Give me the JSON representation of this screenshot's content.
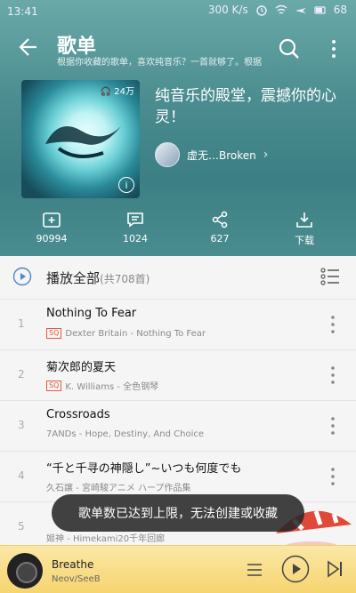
{
  "status": {
    "time": "13:41",
    "net_speed": "300 K/s",
    "battery": "68"
  },
  "header": {
    "title": "歌单",
    "subtitle": "根据你收藏的歌单，喜欢纯音乐？一首就够了。根据"
  },
  "playlist": {
    "play_count": "24万",
    "title": "纯音乐的殿堂，震撼你的心灵！",
    "creator": "虚无…Broken",
    "info_label": "i"
  },
  "actions": [
    {
      "label": "90994",
      "icon": "add-folder-icon"
    },
    {
      "label": "1024",
      "icon": "comment-icon"
    },
    {
      "label": "627",
      "icon": "share-icon"
    },
    {
      "label": "下载",
      "icon": "download-icon"
    }
  ],
  "playall": {
    "label": "播放全部",
    "count": "(共708首)"
  },
  "songs": [
    {
      "num": "1",
      "title": "Nothing To Fear",
      "sq": true,
      "meta": "Dexter Britain - Nothing To Fear"
    },
    {
      "num": "2",
      "title": "菊次郎的夏天",
      "sq": true,
      "meta": "K. Williams - 全色钢琴"
    },
    {
      "num": "3",
      "title": "Crossroads",
      "sq": false,
      "meta": "7ANDs - Hope, Destiny, And Choice"
    },
    {
      "num": "4",
      "title": "“千と千寻の神隠し”~いつも何度でも",
      "sq": false,
      "meta": "久石譲 - 宮崎駿アニメ ハープ作品集"
    },
    {
      "num": "5",
      "title": "",
      "sq": false,
      "meta": "姬神 - Himekami20千年回廊"
    }
  ],
  "sq_badge": "SQ",
  "toast": "歌单数已达到上限，无法创建或收藏",
  "player": {
    "title": "Breathe",
    "artist": "Neov/SeeB"
  }
}
